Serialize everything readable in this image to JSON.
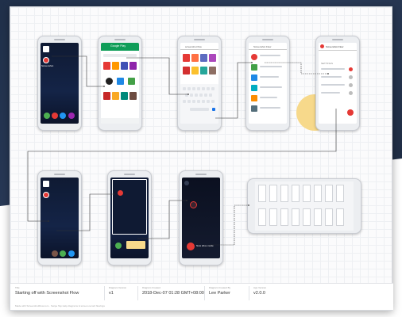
{
  "colors": {
    "accent_red": "#e53935",
    "play_green": "#0f9d58",
    "note_yellow": "#f7d98b",
    "dark_bg": "#1d2a40"
  },
  "footer": {
    "fields": [
      {
        "label": "Title",
        "value": "Starting off with Screenshot Flow"
      },
      {
        "label": "Diagram Version",
        "value": "v1"
      },
      {
        "label": "Diagram Created",
        "value": "2018-Dec-07 01:28 GMT+08:00"
      },
      {
        "label": "Diagram Created By",
        "value": "Lee Parker"
      },
      {
        "label": "App Version",
        "value": "v2.0.0"
      }
    ],
    "note": "Made with ScreenshotFlow.com · Swipe Tap Help diagrams & screen-record flowings"
  },
  "screens": {
    "play_store_title": "Google Play",
    "search_title": "screenshot flow",
    "results_title": "Screenshot Flow",
    "app_title": "Screenshot Flow",
    "settings_title": "SETTINGS",
    "home_label": "Screenshot",
    "overlay_label": "Now drive mode"
  }
}
